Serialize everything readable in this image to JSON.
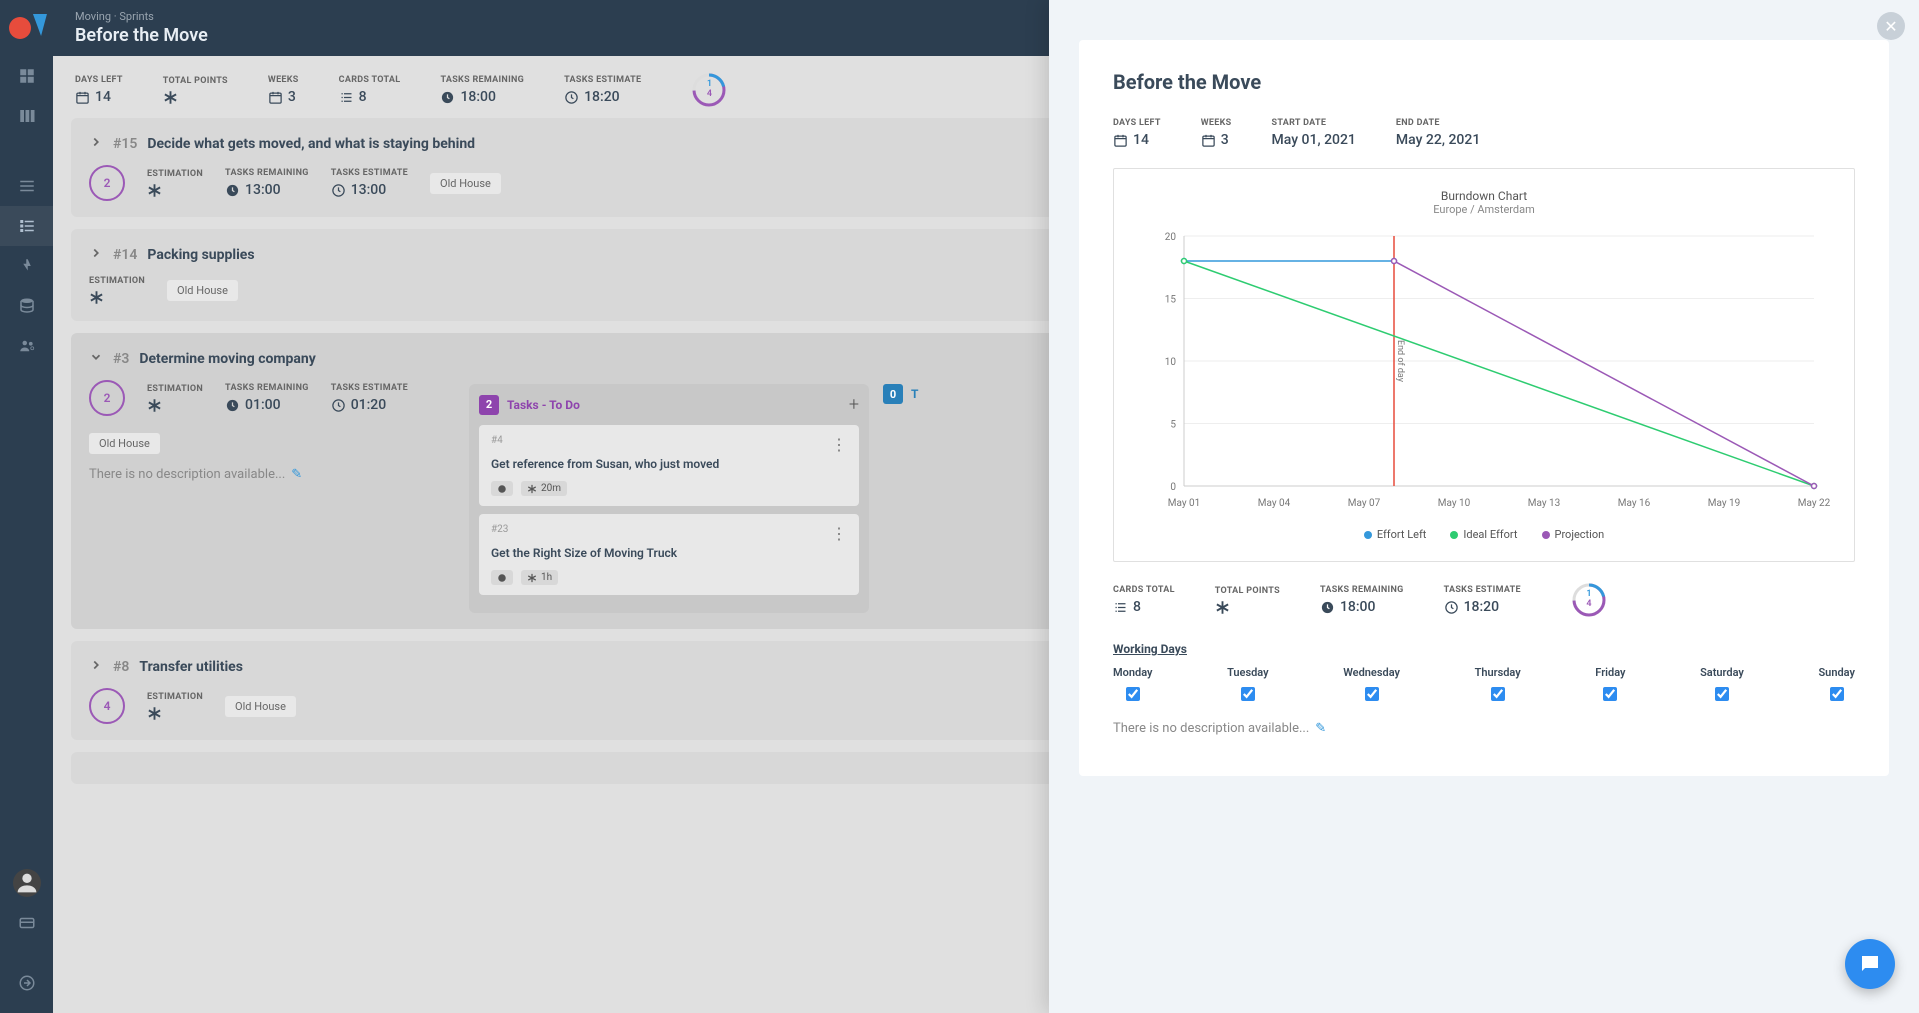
{
  "header": {
    "breadcrumb": "Moving · Sprints",
    "title": "Before the Move"
  },
  "stats": {
    "days_left_label": "DAYS LEFT",
    "days_left": "14",
    "total_points_label": "TOTAL POINTS",
    "weeks_label": "WEEKS",
    "weeks": "3",
    "cards_total_label": "CARDS TOTAL",
    "cards_total": "8",
    "tasks_remaining_label": "TASKS REMAINING",
    "tasks_remaining": "18:00",
    "tasks_estimate_label": "TASKS ESTIMATE",
    "tasks_estimate": "18:20",
    "ring_top": "1",
    "ring_bottom": "4"
  },
  "cards": [
    {
      "id": "#15",
      "title": "Decide what gets moved, and what is staying behind",
      "ring": "2",
      "estimation_label": "ESTIMATION",
      "remaining_label": "TASKS REMAINING",
      "remaining": "13:00",
      "estimate_label": "TASKS ESTIMATE",
      "estimate": "13:00",
      "tag": "Old House"
    },
    {
      "id": "#14",
      "title": "Packing supplies",
      "estimation_label": "ESTIMATION",
      "tag": "Old House"
    },
    {
      "id": "#3",
      "title": "Determine moving company",
      "ring": "2",
      "estimation_label": "ESTIMATION",
      "remaining_label": "TASKS REMAINING",
      "remaining": "01:00",
      "estimate_label": "TASKS ESTIMATE",
      "estimate": "01:20",
      "tag": "Old House",
      "desc": "There is no description available...",
      "column": {
        "badge": "2",
        "title": "Tasks - To Do",
        "tasks": [
          {
            "id": "#4",
            "title": "Get reference from Susan, who just moved",
            "time": "20m"
          },
          {
            "id": "#23",
            "title": "Get the Right Size of Moving Truck",
            "time": "1h"
          }
        ]
      },
      "column2": {
        "badge": "0",
        "title": "T"
      }
    },
    {
      "id": "#8",
      "title": "Transfer utilities",
      "ring": "4",
      "estimation_label": "ESTIMATION",
      "tag": "Old House"
    }
  ],
  "panel": {
    "title": "Before the Move",
    "days_left_label": "DAYS LEFT",
    "days_left": "14",
    "weeks_label": "WEEKS",
    "weeks": "3",
    "start_label": "START DATE",
    "start": "May 01, 2021",
    "end_label": "END DATE",
    "end": "May 22, 2021",
    "cards_total_label": "CARDS TOTAL",
    "cards_total": "8",
    "total_points_label": "TOTAL POINTS",
    "tasks_remaining_label": "TASKS REMAINING",
    "tasks_remaining": "18:00",
    "tasks_estimate_label": "TASKS ESTIMATE",
    "tasks_estimate": "18:20",
    "ring_top": "1",
    "ring_bottom": "4",
    "wd_label": "Working Days",
    "days": [
      "Monday",
      "Tuesday",
      "Wednesday",
      "Thursday",
      "Friday",
      "Saturday",
      "Sunday"
    ],
    "desc": "There is no description available..."
  },
  "chart_data": {
    "type": "line",
    "title": "Burndown Chart",
    "subtitle": "Europe / Amsterdam",
    "xlabel": "",
    "ylabel": "",
    "ylim": [
      0,
      20
    ],
    "x_ticks": [
      "May 01",
      "May 04",
      "May 07",
      "May 10",
      "May 13",
      "May 16",
      "May 19",
      "May 22"
    ],
    "y_ticks": [
      0,
      5,
      10,
      15,
      20
    ],
    "vertical_marker": {
      "x": "May 08",
      "label": "End of day"
    },
    "series": [
      {
        "name": "Effort Left",
        "color": "#3498db",
        "points": [
          {
            "x": "May 01",
            "y": 18
          },
          {
            "x": "May 08",
            "y": 18
          }
        ]
      },
      {
        "name": "Ideal Effort",
        "color": "#2ecc71",
        "points": [
          {
            "x": "May 01",
            "y": 18
          },
          {
            "x": "May 22",
            "y": 0
          }
        ]
      },
      {
        "name": "Projection",
        "color": "#9b59b6",
        "points": [
          {
            "x": "May 08",
            "y": 18
          },
          {
            "x": "May 22",
            "y": 0
          }
        ]
      }
    ],
    "legend_position": "bottom"
  }
}
